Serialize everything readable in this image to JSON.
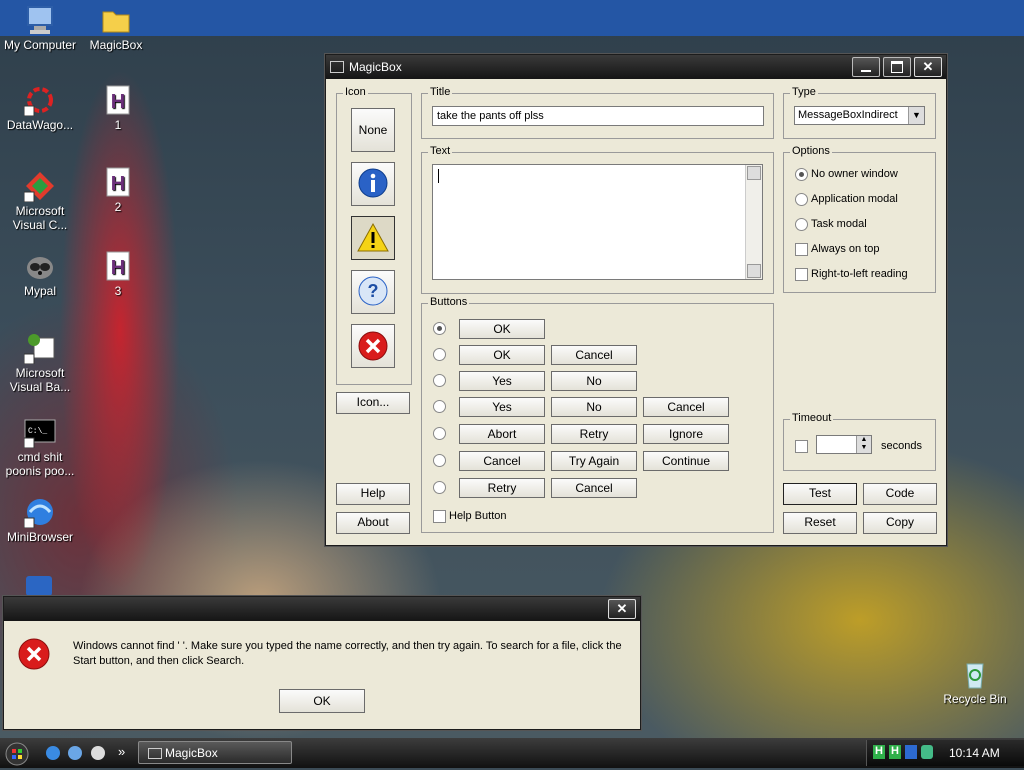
{
  "desktop": {
    "icons": [
      {
        "label": "My Computer",
        "icon": "computer-icon"
      },
      {
        "label": "MagicBox",
        "icon": "folder-icon"
      },
      {
        "label": "DataWago...",
        "icon": "datawagon-icon"
      },
      {
        "label": "1",
        "icon": "h-document-icon"
      },
      {
        "label": "Microsoft Visual C...",
        "icon": "visual-c-icon"
      },
      {
        "label": "2",
        "icon": "h-document-icon"
      },
      {
        "label": "Mypal",
        "icon": "raccoon-icon"
      },
      {
        "label": "3",
        "icon": "h-document-icon"
      },
      {
        "label": "Microsoft Visual Ba...",
        "icon": "visual-basic-icon"
      },
      {
        "label": "cmd shit poonis poo...",
        "icon": "cmd-icon"
      },
      {
        "label": "MiniBrowser",
        "icon": "globe-icon"
      },
      {
        "label": "Recycle Bin",
        "icon": "recycle-bin-icon"
      }
    ],
    "h_letter": "H",
    "cmd_text": "C:\\_"
  },
  "magicbox": {
    "title": "MagicBox",
    "icon_group": {
      "label": "Icon",
      "none": "None",
      "icon_button": "Icon...",
      "selected": "warning"
    },
    "title_group": {
      "label": "Title",
      "value": "take the pants off plss"
    },
    "text_group": {
      "label": "Text",
      "value": ""
    },
    "type_group": {
      "label": "Type",
      "value": "MessageBoxIndirect"
    },
    "options_group": {
      "label": "Options",
      "items": [
        {
          "label": "No owner window",
          "kind": "radio",
          "checked": true
        },
        {
          "label": "Application modal",
          "kind": "radio",
          "checked": false
        },
        {
          "label": "Task modal",
          "kind": "radio",
          "checked": false
        },
        {
          "label": "Always on top",
          "kind": "checkbox",
          "checked": false
        },
        {
          "label": "Right-to-left reading",
          "kind": "checkbox",
          "checked": false
        }
      ]
    },
    "buttons_group": {
      "label": "Buttons",
      "rows": [
        [
          "OK"
        ],
        [
          "OK",
          "Cancel"
        ],
        [
          "Yes",
          "No"
        ],
        [
          "Yes",
          "No",
          "Cancel"
        ],
        [
          "Abort",
          "Retry",
          "Ignore"
        ],
        [
          "Cancel",
          "Try Again",
          "Continue"
        ],
        [
          "Retry",
          "Cancel"
        ]
      ],
      "selected_row": 0,
      "help_button": "Help Button"
    },
    "timeout_group": {
      "label": "Timeout",
      "seconds": "seconds",
      "value": ""
    },
    "help": "Help",
    "about": "About",
    "test": "Test",
    "code": "Code",
    "reset": "Reset",
    "copy": "Copy"
  },
  "error_dialog": {
    "message": "Windows cannot find '   '. Make sure you typed the name correctly, and then try again. To search for a file, click the Start button, and then click Search.",
    "ok": "OK"
  },
  "taskbar": {
    "task_label": "MagicBox",
    "clock": "10:14 AM",
    "chevron": "»",
    "tray_h": "H"
  },
  "colors": {
    "error_red": "#d91c1c",
    "info_blue": "#2a62c6",
    "warning_yellow": "#f5d316",
    "titlebar": "#1e1e1e"
  }
}
